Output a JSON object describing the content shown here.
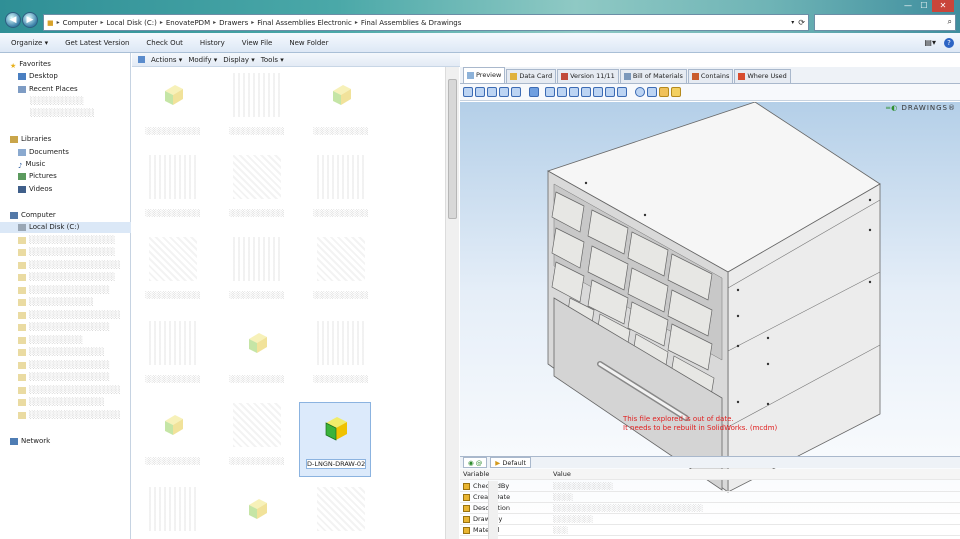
{
  "address": {
    "crumbs": [
      "Computer",
      "Local Disk (C:)",
      "EnovatePDM",
      "Drawers",
      "Final Assemblies Electronic",
      "Final Assemblies & Drawings"
    ]
  },
  "toolbar": {
    "items": [
      "Organize ▾",
      "Get Latest Version",
      "Check Out",
      "History",
      "View File",
      "New Folder"
    ]
  },
  "nav": {
    "favorites_label": "Favorites",
    "favorites": [
      "Desktop",
      "Recent Places"
    ],
    "libraries_label": "Libraries",
    "libraries": [
      "Documents",
      "Music",
      "Pictures",
      "Videos"
    ],
    "computer_label": "Computer",
    "local_disk": "Local Disk (C:)",
    "network_label": "Network"
  },
  "subtoolbar": [
    "Actions ▾",
    "Modify ▾",
    "Display ▾",
    "Tools ▾"
  ],
  "selected_file": "D-LNGN-DRAW-02",
  "tabs": [
    "Preview",
    "Data Card",
    "Version 11/11",
    "Bill of Materials",
    "Contains",
    "Where Used"
  ],
  "viewport": {
    "logo": "DRAWINGS",
    "warning_line1": "This file explored is out of date.",
    "warning_line2": "It needs to be rebuilt in SolidWorks. (mcdm)"
  },
  "props_tab": "Default",
  "props": {
    "col_variable": "Variable",
    "col_value": "Value",
    "rows": [
      "CheckedBy",
      "CreateDate",
      "Description",
      "DrawnBy",
      "Material"
    ]
  },
  "colors": {
    "title_gradient": "#4aa8a8",
    "selection": "#dceafb",
    "warning": "#e01f1f"
  }
}
